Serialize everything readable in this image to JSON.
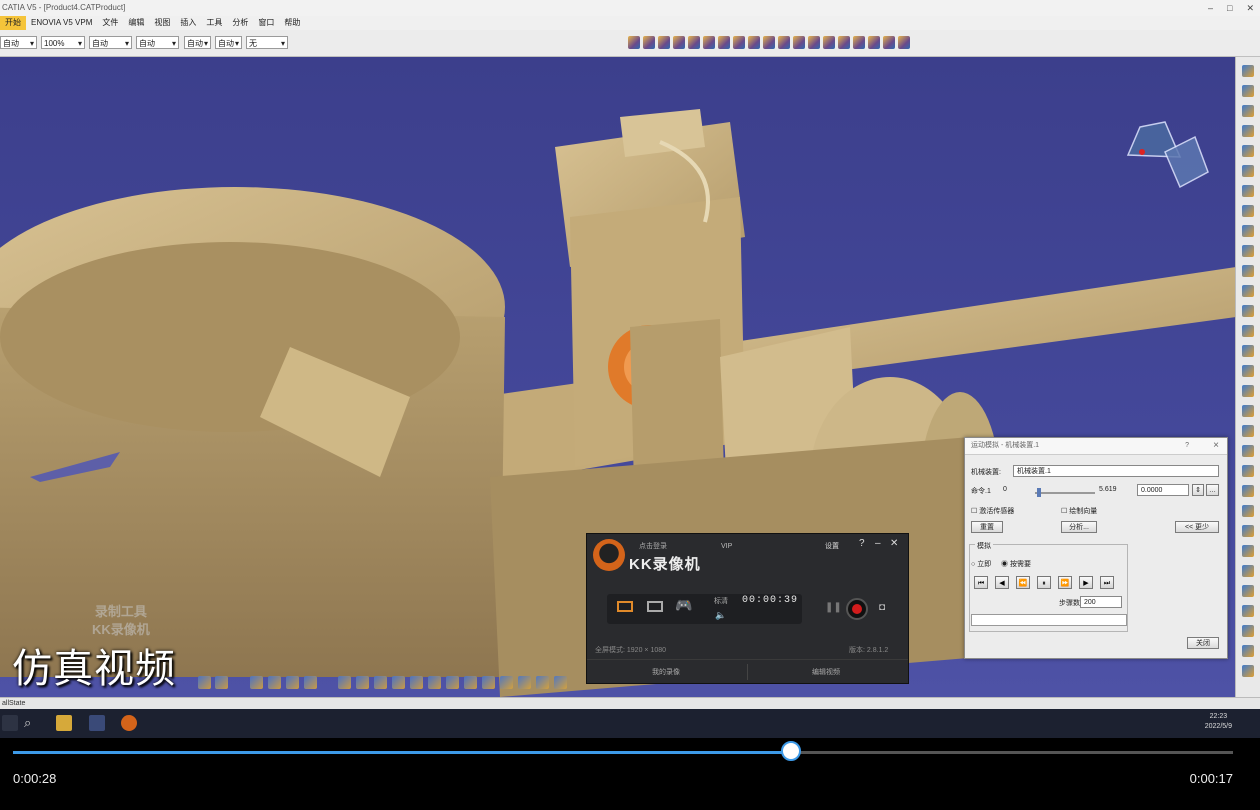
{
  "window": {
    "title": "CATIA V5 - [Product4.CATProduct]"
  },
  "menu": [
    "开始",
    "ENOVIA V5 VPM",
    "文件",
    "编辑",
    "视图",
    "插入",
    "工具",
    "分析",
    "窗口",
    "帮助"
  ],
  "toolbar": {
    "combos": [
      "自动",
      "100%",
      "自动",
      "自动",
      "自动",
      "自动",
      "无"
    ]
  },
  "sim_dialog": {
    "title": "运动模拟 - 机械装置.1",
    "mechanism_label": "机械装置:",
    "mechanism_value": "机械装置.1",
    "command_label": "命令.1",
    "range_min": "0",
    "range_max": "5.619",
    "value": "0.0000",
    "activate_sensors": "激活传感器",
    "plot_vectors": "绘制向量",
    "reset_button": "重置",
    "analysis_button": "分析...",
    "less_button": "<< 更少",
    "simulation_group": "模拟",
    "immediate": "立即",
    "on_request": "按需要",
    "steps_label": "步骤数:",
    "steps_value": "200",
    "close_button": "关闭",
    "play_buttons": [
      "⏮",
      "◀",
      "⏪",
      "⏸",
      "⏩",
      "▶",
      "⏭"
    ]
  },
  "recorder": {
    "subtitle": "点击登录",
    "vip": "VIP",
    "settings": "设置",
    "brand": "KK录像机",
    "quality": "标清",
    "time": "00:00:39",
    "mode": "全屏模式: 1920 × 1080",
    "version": "版本: 2.8.1.2",
    "tab_record": "我的录像",
    "tab_edit": "编辑视频"
  },
  "watermark": {
    "line1": "录制工具",
    "line2": "KK录像机"
  },
  "status_text": "allState",
  "taskbar": {
    "time": "22:23",
    "date": "2022/5/9"
  },
  "video": {
    "caption": "仿真视频",
    "elapsed": "0:00:28",
    "remaining": "0:00:17",
    "progress": 0.638
  },
  "colors": {
    "background_blue": "#3b3f8a",
    "model_beige": "#c8b07d",
    "gear_orange": "#e07a2a",
    "progress_blue": "#3d9ae8"
  }
}
